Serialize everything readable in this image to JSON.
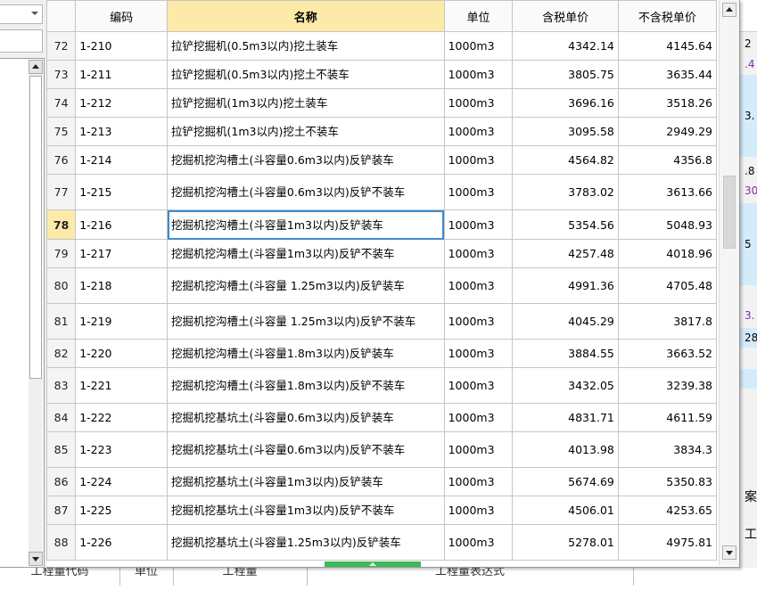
{
  "table": {
    "headers": {
      "index": "",
      "code": "编码",
      "name": "名称",
      "unit": "单位",
      "price_tax": "含税单价",
      "price_notax": "不含税单价"
    },
    "current_row_index": "78",
    "rows": [
      {
        "idx": "72",
        "code": "1-210",
        "name": "拉铲挖掘机(0.5m3以内)挖土装车",
        "unit": "1000m3",
        "tax": "4342.14",
        "notax": "4145.64"
      },
      {
        "idx": "73",
        "code": "1-211",
        "name": "拉铲挖掘机(0.5m3以内)挖土不装车",
        "unit": "1000m3",
        "tax": "3805.75",
        "notax": "3635.44"
      },
      {
        "idx": "74",
        "code": "1-212",
        "name": "拉铲挖掘机(1m3以内)挖土装车",
        "unit": "1000m3",
        "tax": "3696.16",
        "notax": "3518.26"
      },
      {
        "idx": "75",
        "code": "1-213",
        "name": "拉铲挖掘机(1m3以内)挖土不装车",
        "unit": "1000m3",
        "tax": "3095.58",
        "notax": "2949.29"
      },
      {
        "idx": "76",
        "code": "1-214",
        "name": "挖掘机挖沟槽土(斗容量0.6m3以内)反铲装车",
        "unit": "1000m3",
        "tax": "4564.82",
        "notax": "4356.8"
      },
      {
        "idx": "77",
        "code": "1-215",
        "name": "挖掘机挖沟槽土(斗容量0.6m3以内)反铲不装车",
        "unit": "1000m3",
        "tax": "3783.02",
        "notax": "3613.66"
      },
      {
        "idx": "78",
        "code": "1-216",
        "name": "挖掘机挖沟槽土(斗容量1m3以内)反铲装车",
        "unit": "1000m3",
        "tax": "5354.56",
        "notax": "5048.93"
      },
      {
        "idx": "79",
        "code": "1-217",
        "name": "挖掘机挖沟槽土(斗容量1m3以内)反铲不装车",
        "unit": "1000m3",
        "tax": "4257.48",
        "notax": "4018.96"
      },
      {
        "idx": "80",
        "code": "1-218",
        "name": "挖掘机挖沟槽土(斗容量 1.25m3以内)反铲装车",
        "unit": "1000m3",
        "tax": "4991.36",
        "notax": "4705.48"
      },
      {
        "idx": "81",
        "code": "1-219",
        "name": "挖掘机挖沟槽土(斗容量 1.25m3以内)反铲不装车",
        "unit": "1000m3",
        "tax": "4045.29",
        "notax": "3817.8"
      },
      {
        "idx": "82",
        "code": "1-220",
        "name": "挖掘机挖沟槽土(斗容量1.8m3以内)反铲装车",
        "unit": "1000m3",
        "tax": "3884.55",
        "notax": "3663.52"
      },
      {
        "idx": "83",
        "code": "1-221",
        "name": "挖掘机挖沟槽土(斗容量1.8m3以内)反铲不装车",
        "unit": "1000m3",
        "tax": "3432.05",
        "notax": "3239.38"
      },
      {
        "idx": "84",
        "code": "1-222",
        "name": "挖掘机挖基坑土(斗容量0.6m3以内)反铲装车",
        "unit": "1000m3",
        "tax": "4831.71",
        "notax": "4611.59"
      },
      {
        "idx": "85",
        "code": "1-223",
        "name": "挖掘机挖基坑土(斗容量0.6m3以内)反铲不装车",
        "unit": "1000m3",
        "tax": "4013.98",
        "notax": "3834.3"
      },
      {
        "idx": "86",
        "code": "1-224",
        "name": "挖掘机挖基坑土(斗容量1m3以内)反铲装车",
        "unit": "1000m3",
        "tax": "5674.69",
        "notax": "5350.83"
      },
      {
        "idx": "87",
        "code": "1-225",
        "name": "挖掘机挖基坑土(斗容量1m3以内)反铲不装车",
        "unit": "1000m3",
        "tax": "4506.01",
        "notax": "4253.65"
      },
      {
        "idx": "88",
        "code": "1-226",
        "name": "挖掘机挖基坑土(斗容量1.25m3以内)反铲装车",
        "unit": "1000m3",
        "tax": "5278.01",
        "notax": "4975.81"
      }
    ]
  },
  "background": {
    "right_fragments": [
      "2",
      ".4",
      "3.",
      ".8",
      "30",
      "5",
      "3.",
      "28",
      "案",
      "工程"
    ],
    "bottom_headers": [
      "工程量代码",
      "单位",
      "工程量",
      "工程量表达式"
    ]
  },
  "colors": {
    "header_highlight": "#fde9a8",
    "selection_border": "#3c8bd1",
    "splitter_handle": "#3dba56"
  }
}
